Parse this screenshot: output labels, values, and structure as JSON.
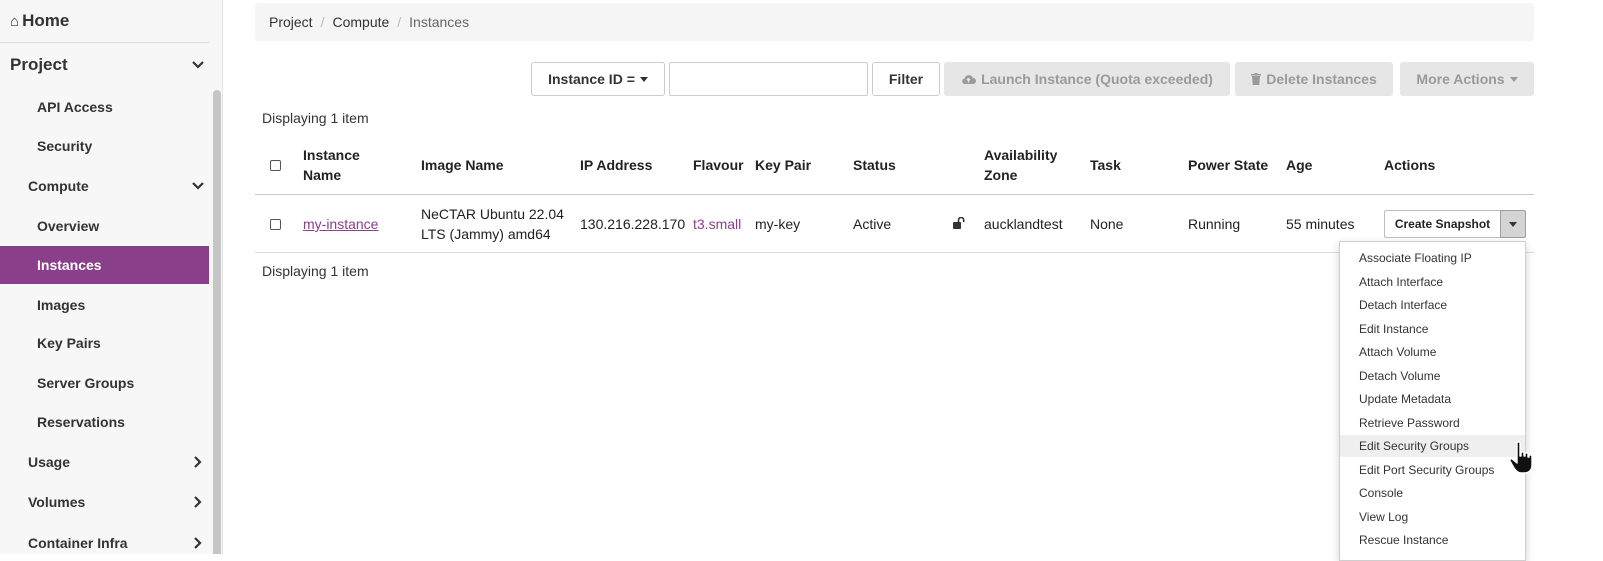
{
  "sidebar": {
    "home": "Home",
    "project": "Project",
    "items": {
      "api_access": "API Access",
      "security": "Security",
      "compute": "Compute",
      "overview": "Overview",
      "instances": "Instances",
      "images": "Images",
      "key_pairs": "Key Pairs",
      "server_groups": "Server Groups",
      "reservations": "Reservations",
      "usage": "Usage",
      "volumes": "Volumes",
      "container_infra": "Container Infra"
    },
    "active_color": "#8a3f8a"
  },
  "breadcrumb": {
    "project": "Project",
    "compute": "Compute",
    "current": "Instances",
    "separator": "/"
  },
  "toolbar": {
    "filter_select": "Instance ID =",
    "filter_value": "",
    "filter_button": "Filter",
    "launch_button": "Launch Instance (Quota exceeded)",
    "delete_button": "Delete Instances",
    "more_actions": "More Actions"
  },
  "table": {
    "displaying_top": "Displaying 1 item",
    "displaying_bottom": "Displaying 1 item",
    "headers": {
      "name_line1": "Instance",
      "name_line2": "Name",
      "image": "Image Name",
      "ip": "IP Address",
      "flavour": "Flavour",
      "key_pair": "Key Pair",
      "status": "Status",
      "az_line1": "Availability",
      "az_line2": "Zone",
      "task": "Task",
      "power": "Power State",
      "age": "Age",
      "actions": "Actions"
    },
    "row": {
      "name": "my-instance",
      "image_line1": "NeCTAR Ubuntu 22.04",
      "image_line2": "LTS (Jammy) amd64",
      "ip": "130.216.228.170",
      "flavour": "t3.small",
      "key_pair": "my-key",
      "status": "Active",
      "lock_icon": "unlock-icon",
      "az": "aucklandtest",
      "task": "None",
      "power": "Running",
      "age": "55 minutes",
      "action": "Create Snapshot"
    }
  },
  "dropdown": {
    "items": [
      "Associate Floating IP",
      "Attach Interface",
      "Detach Interface",
      "Edit Instance",
      "Attach Volume",
      "Detach Volume",
      "Update Metadata",
      "Retrieve Password",
      "Edit Security Groups",
      "Edit Port Security Groups",
      "Console",
      "View Log",
      "Rescue Instance"
    ],
    "hovered": "Edit Security Groups"
  }
}
